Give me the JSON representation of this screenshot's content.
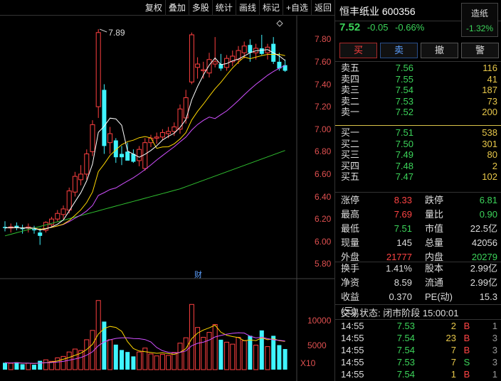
{
  "toolbar": [
    "复权",
    "叠加",
    "多股",
    "统计",
    "画线",
    "标记",
    "+自选",
    "返回"
  ],
  "stock": {
    "name": "恒丰纸业",
    "code": "600356",
    "price": "7.52",
    "change": "-0.05",
    "change_pct": "-0.66%"
  },
  "sector": {
    "name": "造纸",
    "change_pct": "-1.32%"
  },
  "actions": [
    "买",
    "卖",
    "撤",
    "警"
  ],
  "orderbook": {
    "asks": [
      {
        "label": "卖五",
        "price": "7.56",
        "volume": "116"
      },
      {
        "label": "卖四",
        "price": "7.55",
        "volume": "41"
      },
      {
        "label": "卖三",
        "price": "7.54",
        "volume": "187"
      },
      {
        "label": "卖二",
        "price": "7.53",
        "volume": "73"
      },
      {
        "label": "卖一",
        "price": "7.52",
        "volume": "200"
      }
    ],
    "bids": [
      {
        "label": "买一",
        "price": "7.51",
        "volume": "538"
      },
      {
        "label": "买二",
        "price": "7.50",
        "volume": "301"
      },
      {
        "label": "买三",
        "price": "7.49",
        "volume": "80"
      },
      {
        "label": "买四",
        "price": "7.48",
        "volume": "2"
      },
      {
        "label": "买五",
        "price": "7.47",
        "volume": "102"
      }
    ]
  },
  "stats1": [
    {
      "k": "涨停",
      "v": "8.33",
      "vc": "r",
      "k2": "跌停",
      "v2": "6.81",
      "v2c": "g"
    },
    {
      "k": "最高",
      "v": "7.69",
      "vc": "r",
      "k2": "量比",
      "v2": "0.90",
      "v2c": "g"
    },
    {
      "k": "最低",
      "v": "7.51",
      "vc": "g",
      "k2": "市值",
      "v2": "22.5亿",
      "v2c": "w"
    },
    {
      "k": "现量",
      "v": "145",
      "vc": "w",
      "k2": "总量",
      "v2": "42056",
      "v2c": "w"
    },
    {
      "k": "外盘",
      "v": "21777",
      "vc": "r",
      "k2": "内盘",
      "v2": "20279",
      "v2c": "g"
    }
  ],
  "stats2": [
    {
      "k": "换手",
      "v": "1.41%",
      "vc": "w",
      "k2": "股本",
      "v2": "2.99亿",
      "v2c": "w"
    },
    {
      "k": "净资",
      "v": "8.59",
      "vc": "w",
      "k2": "流通",
      "v2": "2.99亿",
      "v2c": "w"
    },
    {
      "k": "收益(三)",
      "v": "0.370",
      "vc": "w",
      "k2": "PE(动)",
      "v2": "15.3",
      "v2c": "w"
    }
  ],
  "trade_status": "交易状态: 闭市阶段 15:00:01",
  "ticks": [
    {
      "t": "14:55",
      "p": "7.53",
      "pc": "g",
      "v": "2",
      "s": "B",
      "sc": "r",
      "n": "1"
    },
    {
      "t": "14:55",
      "p": "7.54",
      "pc": "g",
      "v": "23",
      "s": "B",
      "sc": "r",
      "n": "3"
    },
    {
      "t": "14:55",
      "p": "7.54",
      "pc": "g",
      "v": "7",
      "s": "B",
      "sc": "r",
      "n": "3"
    },
    {
      "t": "14:55",
      "p": "7.53",
      "pc": "g",
      "v": "7",
      "s": "S",
      "sc": "g",
      "n": "3"
    },
    {
      "t": "14:55",
      "p": "7.54",
      "pc": "g",
      "v": "1",
      "s": "B",
      "sc": "r",
      "n": "1"
    }
  ],
  "chart_data": {
    "type": "candlestick",
    "price_axis": {
      "ticks": [
        "7.80",
        "7.60",
        "7.40",
        "7.20",
        "7.00",
        "6.80",
        "6.60",
        "6.40",
        "6.20",
        "6.00",
        "5.80"
      ],
      "range": [
        5.72,
        7.96
      ]
    },
    "volume_axis": {
      "ticks": [
        "10000",
        "5000"
      ],
      "unit_label": "X10",
      "range": [
        0,
        14500
      ]
    },
    "high_marker": "7.89",
    "event_marker": "财",
    "candles": [
      {
        "o": 6.13,
        "h": 6.18,
        "l": 6.09,
        "c": 6.12,
        "v": 1400
      },
      {
        "o": 6.12,
        "h": 6.16,
        "l": 6.08,
        "c": 6.13,
        "v": 1300
      },
      {
        "o": 6.14,
        "h": 6.17,
        "l": 6.1,
        "c": 6.12,
        "v": 1500
      },
      {
        "o": 6.12,
        "h": 6.15,
        "l": 6.07,
        "c": 6.11,
        "v": 1100
      },
      {
        "o": 6.12,
        "h": 6.16,
        "l": 6.08,
        "c": 6.13,
        "v": 1300
      },
      {
        "o": 6.11,
        "h": 6.14,
        "l": 6.07,
        "c": 6.1,
        "v": 1000
      },
      {
        "o": 6.08,
        "h": 6.12,
        "l": 5.97,
        "c": 6.05,
        "v": 1800
      },
      {
        "o": 6.1,
        "h": 6.18,
        "l": 6.08,
        "c": 6.17,
        "v": 2000
      },
      {
        "o": 6.15,
        "h": 6.22,
        "l": 6.13,
        "c": 6.2,
        "v": 1700
      },
      {
        "o": 6.2,
        "h": 6.28,
        "l": 6.18,
        "c": 6.25,
        "v": 2400
      },
      {
        "o": 6.24,
        "h": 6.32,
        "l": 6.2,
        "c": 6.29,
        "v": 2700
      },
      {
        "o": 6.28,
        "h": 6.48,
        "l": 6.25,
        "c": 6.45,
        "v": 3600
      },
      {
        "o": 6.44,
        "h": 6.62,
        "l": 6.4,
        "c": 6.58,
        "v": 4200
      },
      {
        "o": 6.55,
        "h": 6.68,
        "l": 6.5,
        "c": 6.6,
        "v": 3900
      },
      {
        "o": 6.6,
        "h": 6.82,
        "l": 6.55,
        "c": 6.78,
        "v": 6100
      },
      {
        "o": 6.8,
        "h": 7.08,
        "l": 6.76,
        "c": 7.04,
        "v": 8000
      },
      {
        "o": 7.2,
        "h": 7.89,
        "l": 7.1,
        "c": 7.86,
        "v": 14100
      },
      {
        "o": 7.35,
        "h": 7.4,
        "l": 6.78,
        "c": 6.85,
        "v": 9800
      },
      {
        "o": 6.88,
        "h": 7.02,
        "l": 6.78,
        "c": 6.96,
        "v": 6100
      },
      {
        "o": 6.9,
        "h": 6.92,
        "l": 6.7,
        "c": 6.75,
        "v": 5100
      },
      {
        "o": 6.78,
        "h": 6.85,
        "l": 6.68,
        "c": 6.75,
        "v": 4000
      },
      {
        "o": 6.8,
        "h": 6.88,
        "l": 6.74,
        "c": 6.72,
        "v": 3600
      },
      {
        "o": 6.78,
        "h": 6.82,
        "l": 6.7,
        "c": 6.71,
        "v": 2700
      },
      {
        "o": 6.72,
        "h": 6.85,
        "l": 6.67,
        "c": 6.82,
        "v": 3600
      },
      {
        "o": 6.65,
        "h": 6.92,
        "l": 6.63,
        "c": 6.88,
        "v": 4400
      },
      {
        "o": 6.88,
        "h": 6.95,
        "l": 6.84,
        "c": 6.92,
        "v": 3200
      },
      {
        "o": 6.92,
        "h": 6.97,
        "l": 6.87,
        "c": 6.93,
        "v": 2800
      },
      {
        "o": 6.93,
        "h": 7.0,
        "l": 6.9,
        "c": 6.97,
        "v": 3100
      },
      {
        "o": 6.96,
        "h": 7.02,
        "l": 6.92,
        "c": 6.98,
        "v": 2900
      },
      {
        "o": 6.98,
        "h": 7.06,
        "l": 6.94,
        "c": 7.02,
        "v": 3500
      },
      {
        "o": 7.0,
        "h": 7.22,
        "l": 6.96,
        "c": 7.18,
        "v": 5400
      },
      {
        "o": 7.1,
        "h": 7.35,
        "l": 7.05,
        "c": 7.28,
        "v": 6500
      },
      {
        "o": 7.42,
        "h": 7.86,
        "l": 7.4,
        "c": 7.84,
        "v": 13300
      },
      {
        "o": 7.55,
        "h": 7.64,
        "l": 7.45,
        "c": 7.58,
        "v": 8600
      },
      {
        "o": 7.52,
        "h": 7.6,
        "l": 7.45,
        "c": 7.53,
        "v": 6600
      },
      {
        "o": 7.5,
        "h": 7.68,
        "l": 7.46,
        "c": 7.62,
        "v": 7600
      },
      {
        "o": 7.58,
        "h": 7.82,
        "l": 7.55,
        "c": 7.6,
        "v": 9200
      },
      {
        "o": 7.58,
        "h": 7.67,
        "l": 7.52,
        "c": 7.54,
        "v": 6100
      },
      {
        "o": 7.55,
        "h": 7.66,
        "l": 7.52,
        "c": 7.63,
        "v": 5600
      },
      {
        "o": 7.6,
        "h": 7.7,
        "l": 7.56,
        "c": 7.65,
        "v": 5200
      },
      {
        "o": 7.62,
        "h": 7.74,
        "l": 7.58,
        "c": 7.7,
        "v": 6600
      },
      {
        "o": 7.68,
        "h": 7.78,
        "l": 7.63,
        "c": 7.74,
        "v": 5900
      },
      {
        "o": 7.75,
        "h": 7.8,
        "l": 7.6,
        "c": 7.68,
        "v": 6900
      },
      {
        "o": 7.68,
        "h": 7.76,
        "l": 7.62,
        "c": 7.72,
        "v": 5000
      },
      {
        "o": 7.72,
        "h": 7.84,
        "l": 7.66,
        "c": 7.67,
        "v": 8000
      },
      {
        "o": 7.68,
        "h": 7.76,
        "l": 7.62,
        "c": 7.73,
        "v": 4700
      },
      {
        "o": 7.76,
        "h": 7.82,
        "l": 7.58,
        "c": 7.6,
        "v": 6900
      },
      {
        "o": 7.6,
        "h": 7.68,
        "l": 7.52,
        "c": 7.54,
        "v": 5000
      },
      {
        "o": 7.57,
        "h": 7.62,
        "l": 7.51,
        "c": 7.52,
        "v": 4200
      }
    ],
    "colors": {
      "up": "#ff4040",
      "down": "#3ff4ff",
      "ma5": "#ffffff",
      "ma10": "#ffd700",
      "ma20": "#d050ff",
      "ma60": "#30c030"
    }
  }
}
